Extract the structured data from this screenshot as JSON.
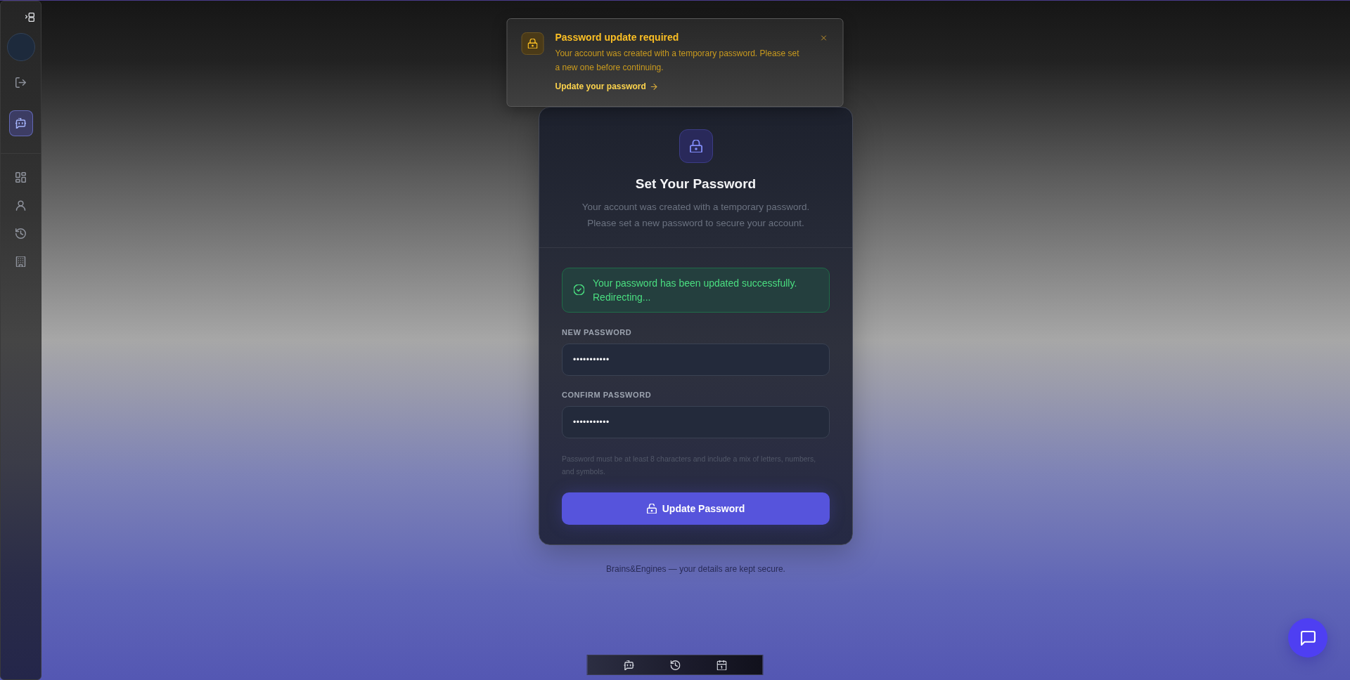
{
  "notification": {
    "title": "Password update required",
    "message": "Your account was created with a temporary password. Please set a new one before continuing.",
    "link": "Update your password"
  },
  "sidebar": {
    "top_nav": [
      {
        "selected": true
      }
    ],
    "nav": [
      {
        "selected": false
      },
      {
        "selected": false
      },
      {
        "selected": false
      },
      {
        "selected": false
      }
    ]
  },
  "card": {
    "title": "Set Your Password",
    "subtitle": "Your account was created with a temporary password. Please set a new password to secure your account.",
    "alert": {
      "kind": "success",
      "message": "Your password has been updated successfully. Redirecting..."
    },
    "fields": [
      {
        "label": "NEW PASSWORD",
        "value": "•••••••••••"
      },
      {
        "label": "CONFIRM PASSWORD",
        "value": "•••••••••••"
      }
    ],
    "hint": "Password must be at least 8 characters and include a mix of letters, numbers, and symbols.",
    "submit": "Update Password"
  },
  "footer": "Brains&Engines — your details are kept secure."
}
